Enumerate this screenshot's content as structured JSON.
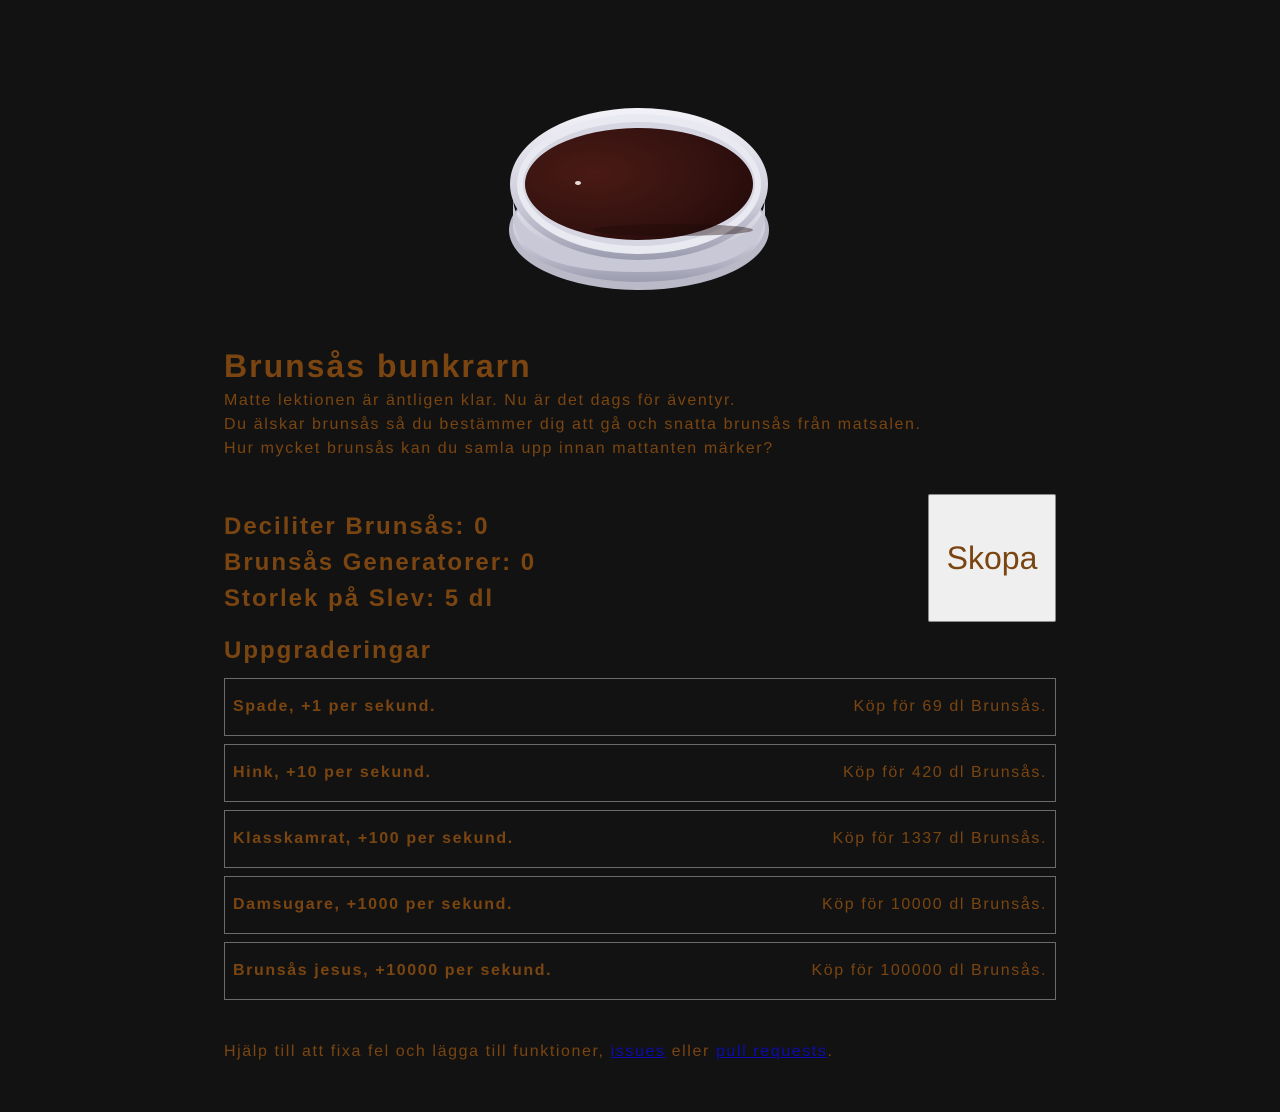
{
  "header": {
    "image_name": "bowl-of-brown-sauce",
    "title": "Brunsås bunkrarn",
    "intro": [
      "Matte lektionen är äntligen klar. Nu är det dags för äventyr.",
      "Du älskar brunsås så du bestämmer dig att gå och snatta brunsås från matsalen.",
      "Hur mycket brunsås kan du samla upp innan mattanten märker?"
    ]
  },
  "stats": {
    "deciliter": "Deciliter Brunsås: 0",
    "generators": "Brunsås Generatorer: 0",
    "ladle": "Storlek på Slev: 5 dl"
  },
  "actions": {
    "scoop_label": "Skopa"
  },
  "upgrades": {
    "title": "Uppgraderingar",
    "items": [
      {
        "name": "Spade, +1 per sekund.",
        "price": "Köp för 69 dl Brunsås."
      },
      {
        "name": "Hink, +10 per sekund.",
        "price": "Köp för 420 dl Brunsås."
      },
      {
        "name": "Klasskamrat, +100 per sekund.",
        "price": "Köp för 1337 dl Brunsås."
      },
      {
        "name": "Damsugare, +1000 per sekund.",
        "price": "Köp för 10000 dl Brunsås."
      },
      {
        "name": "Brunsås jesus, +10000 per sekund.",
        "price": "Köp för 100000 dl Brunsås."
      }
    ]
  },
  "footer": {
    "prefix": "Hjälp till att fixa fel och lägga till funktioner, ",
    "link_issues": "issues",
    "middle": " eller ",
    "link_pulls": "pull requests",
    "suffix": "."
  },
  "colors": {
    "background": "#121212",
    "text": "#7a4510",
    "button_bg": "#efefef",
    "link": "#0b0bb0"
  }
}
